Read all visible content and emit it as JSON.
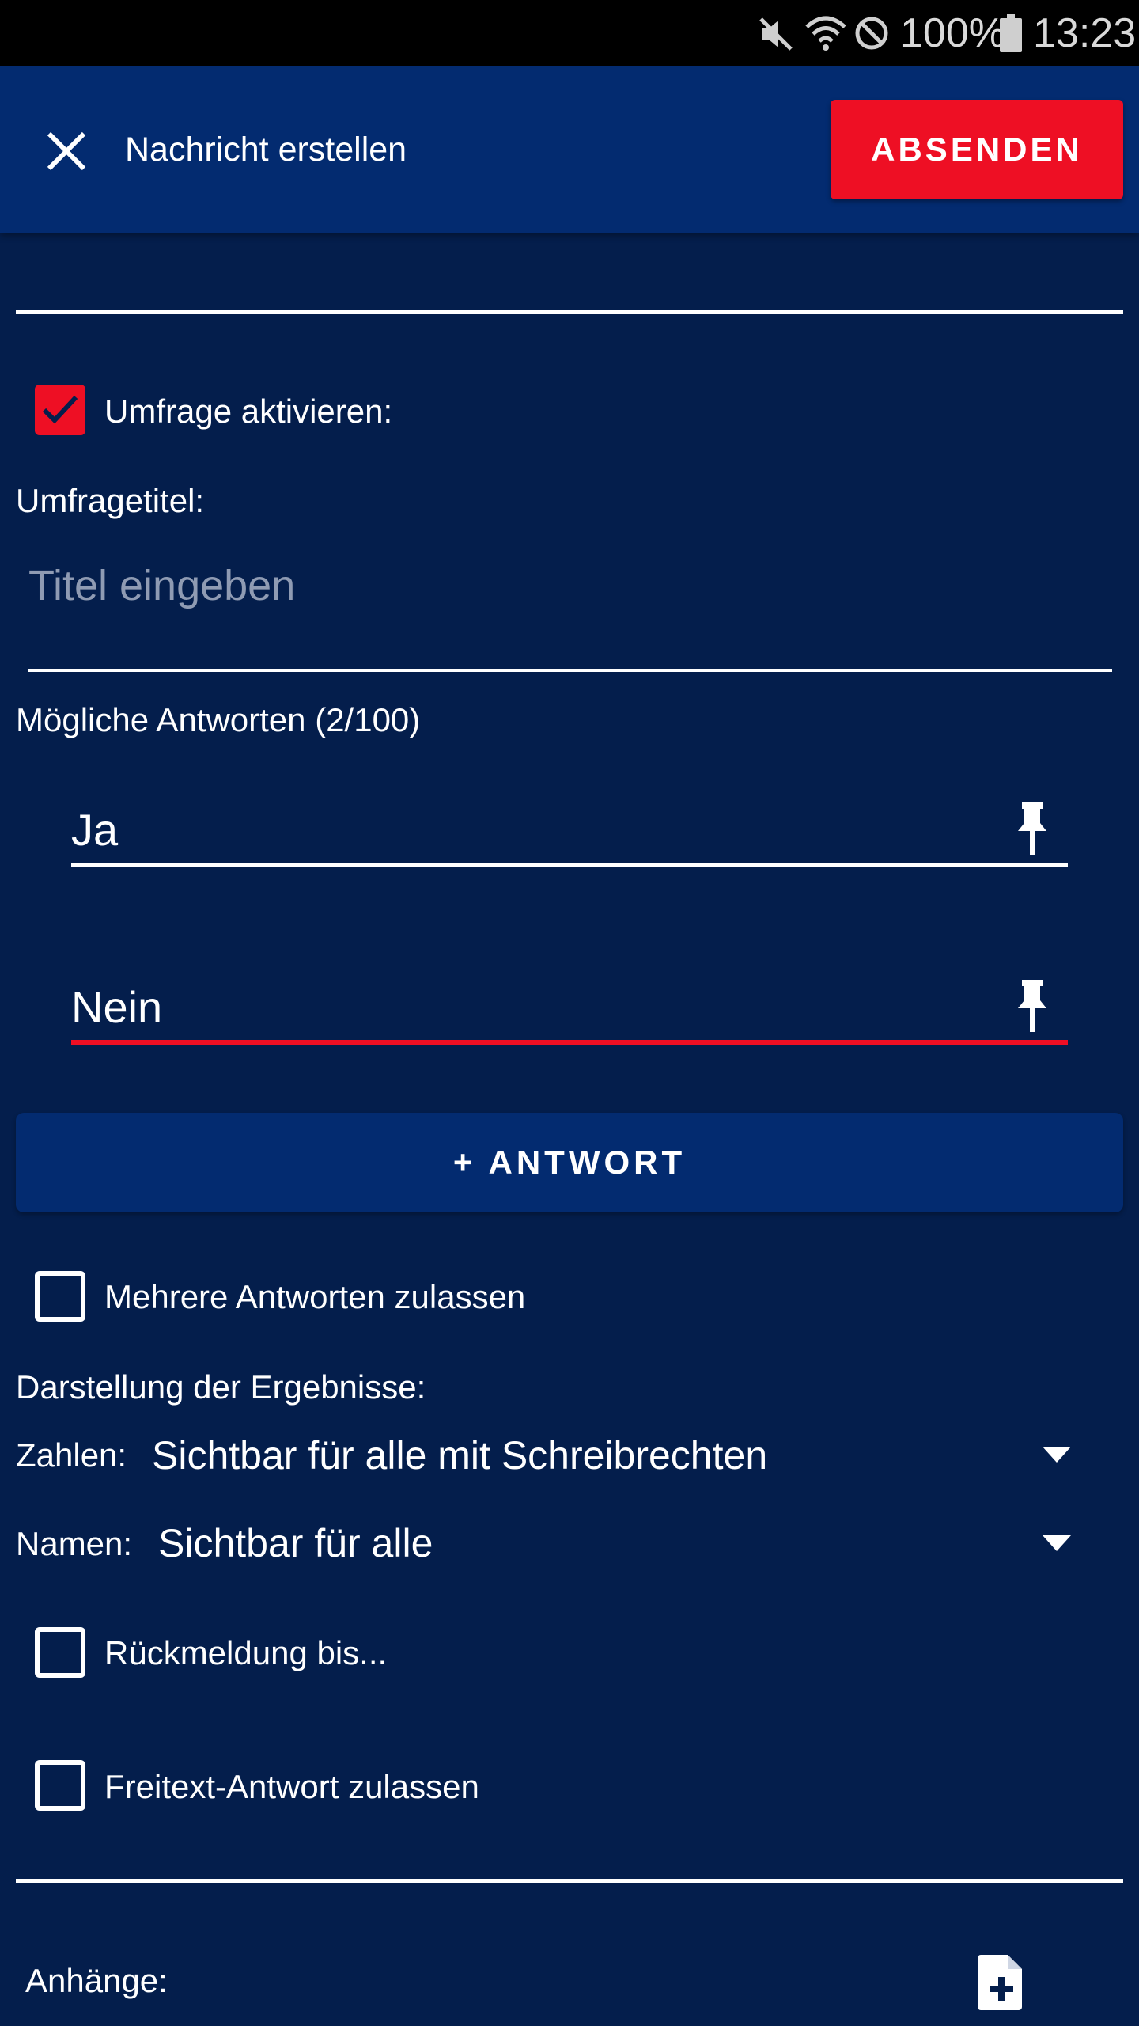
{
  "status_bar": {
    "battery": "100%",
    "time": "13:23"
  },
  "app_bar": {
    "title": "Nachricht erstellen",
    "send_label": "ABSENDEN"
  },
  "poll": {
    "enable_label": "Umfrage aktivieren:",
    "enabled": true,
    "title_label": "Umfragetitel:",
    "title_placeholder": "Titel eingeben",
    "title_value": "",
    "answers_label": "Mögliche Antworten (2/100)",
    "answers": [
      {
        "value": "Ja",
        "focused": false
      },
      {
        "value": "Nein",
        "focused": true
      }
    ],
    "add_answer_label": "+ ANTWORT",
    "multiple_label": "Mehrere Antworten zulassen",
    "multiple_checked": false,
    "results_heading": "Darstellung der Ergebnisse:",
    "numbers_label": "Zahlen:",
    "numbers_value": "Sichtbar für alle mit Schreibrechten",
    "names_label": "Namen:",
    "names_value": "Sichtbar für alle",
    "deadline_label": "Rückmeldung bis...",
    "deadline_checked": false,
    "freetext_label": "Freitext-Antwort zulassen",
    "freetext_checked": false
  },
  "attachments": {
    "label": "Anhänge:"
  },
  "colors": {
    "background": "#041e4c",
    "bar": "#032b70",
    "accent": "#ee0f24"
  }
}
